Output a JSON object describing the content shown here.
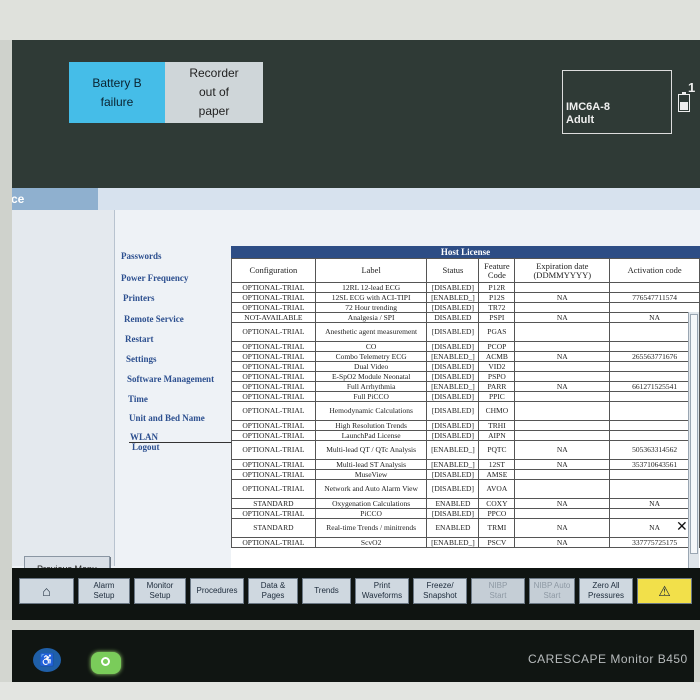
{
  "alarms": [
    {
      "text": "Battery B\nfailure",
      "color": "#45bde8"
    },
    {
      "text": "Recorder\nout of\npaper",
      "color": "#cfd6d9"
    }
  ],
  "patient": {
    "bed": "IMC6A-8",
    "category": "Adult",
    "bed_number_partial": "1"
  },
  "service": {
    "title": "vice",
    "menu": [
      "Passwords",
      "Power Frequency",
      "Printers",
      "Remote Service",
      "Restart",
      "Settings",
      "Software Management",
      "Time",
      "Unit and Bed Name",
      "WLAN",
      "Logout"
    ],
    "previous_menu": "Previous Menu"
  },
  "license_table": {
    "title": "Host License",
    "headers": [
      "Configuration",
      "Label",
      "Status",
      "Feature\nCode",
      "Expiration date\n(DDMMYYYY)",
      "Activation code"
    ],
    "rows": [
      [
        "OPTIONAL-TRIAL",
        "12RL 12-lead ECG",
        "[DISABLED]",
        "P12R",
        "",
        ""
      ],
      [
        "OPTIONAL-TRIAL",
        "12SL ECG with ACI-TIPI",
        "[ENABLED_]",
        "P12S",
        "NA",
        "776547711574"
      ],
      [
        "OPTIONAL-TRIAL",
        "72 Hour trending",
        "[DISABLED]",
        "TR72",
        "",
        ""
      ],
      [
        "NOT-AVAILABLE",
        "Analgesia / SPI",
        "DISABLED",
        "PSPI",
        "NA",
        "NA"
      ],
      [
        "OPTIONAL-TRIAL",
        "Anesthetic agent measurement",
        "[DISABLED]",
        "PGAS",
        "",
        ""
      ],
      [
        "OPTIONAL-TRIAL",
        "CO",
        "[DISABLED]",
        "PCOP",
        "",
        ""
      ],
      [
        "OPTIONAL-TRIAL",
        "Combo Telemetry ECG",
        "[ENABLED_]",
        "ACMB",
        "NA",
        "265563771676"
      ],
      [
        "OPTIONAL-TRIAL",
        "Dual Video",
        "[DISABLED]",
        "VID2",
        "",
        ""
      ],
      [
        "OPTIONAL-TRIAL",
        "E-SpO2 Module Neonatal",
        "[DISABLED]",
        "PSPO",
        "",
        ""
      ],
      [
        "OPTIONAL-TRIAL",
        "Full Arrhythmia",
        "[ENABLED_]",
        "PARR",
        "NA",
        "661271525541"
      ],
      [
        "OPTIONAL-TRIAL",
        "Full PiCCO",
        "[DISABLED]",
        "PPIC",
        "",
        ""
      ],
      [
        "OPTIONAL-TRIAL",
        "Hemodynamic Calculations",
        "[DISABLED]",
        "CHMO",
        "",
        ""
      ],
      [
        "OPTIONAL-TRIAL",
        "High Resolution Trends",
        "[DISABLED]",
        "TRHI",
        "",
        ""
      ],
      [
        "OPTIONAL-TRIAL",
        "LaunchPad License",
        "[DISABLED]",
        "AIPN",
        "",
        ""
      ],
      [
        "OPTIONAL-TRIAL",
        "Multi-lead QT / QTc Analysis",
        "[ENABLED_]",
        "PQTC",
        "NA",
        "505363314562"
      ],
      [
        "OPTIONAL-TRIAL",
        "Multi-lead ST Analysis",
        "[ENABLED_]",
        "12ST",
        "NA",
        "353710643561"
      ],
      [
        "OPTIONAL-TRIAL",
        "MuseView",
        "[DISABLED]",
        "AMSE",
        "",
        ""
      ],
      [
        "OPTIONAL-TRIAL",
        "Network and Auto Alarm View",
        "[DISABLED]",
        "AVOA",
        "",
        ""
      ],
      [
        "STANDARD",
        "Oxygenation Calculations",
        "ENABLED",
        "COXY",
        "NA",
        "NA"
      ],
      [
        "OPTIONAL-TRIAL",
        "PiCCO",
        "[DISABLED]",
        "PPCO",
        "",
        ""
      ],
      [
        "STANDARD",
        "Real-time Trends / minitrends",
        "ENABLED",
        "TRMI",
        "NA",
        "NA"
      ],
      [
        "OPTIONAL-TRIAL",
        "ScvO2",
        "[ENABLED_]",
        "PSCV",
        "NA",
        "337775725175"
      ]
    ]
  },
  "softkeys": [
    {
      "label": "",
      "icon": "home-icon"
    },
    {
      "label": "Alarm\nSetup"
    },
    {
      "label": "Monitor\nSetup"
    },
    {
      "label": "Procedures"
    },
    {
      "label": "Data &\nPages"
    },
    {
      "label": "Trends"
    },
    {
      "label": "Print\nWaveforms"
    },
    {
      "label": "Freeze/\nSnapshot"
    },
    {
      "label": "NIBP\nStart",
      "disabled": true
    },
    {
      "label": "NIBP Auto\nStart",
      "disabled": true
    },
    {
      "label": "Zero All\nPressures"
    },
    {
      "label": "",
      "icon": "alarm-bell-icon"
    }
  ],
  "device": {
    "brand": "CARESCAPE Monitor B450"
  },
  "colors": {
    "alarm_battery": "#45bde8",
    "host_license_header": "#2d4d85",
    "menu_text": "#2c4f8f",
    "alarm_key": "#f2e04a"
  }
}
